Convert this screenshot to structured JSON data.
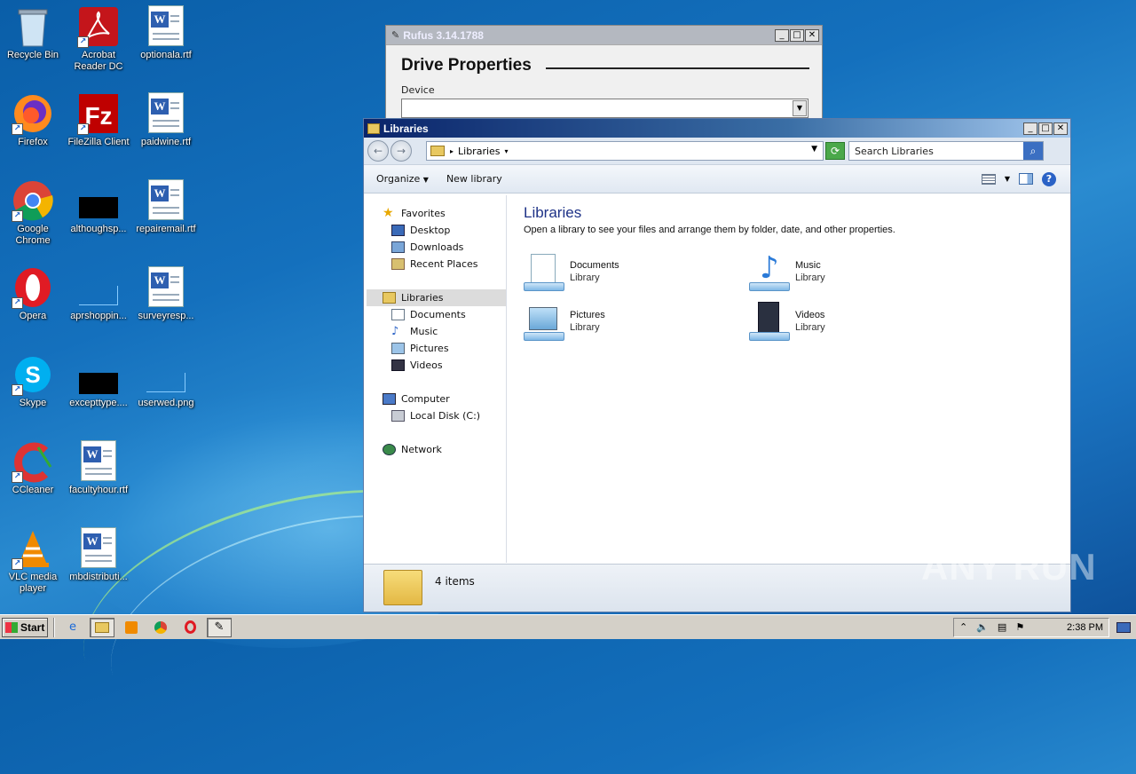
{
  "desktop": {
    "icons": [
      {
        "label": "Recycle Bin",
        "icon": "recycle-bin-icon"
      },
      {
        "label": "Acrobat Reader DC",
        "icon": "acrobat-icon"
      },
      {
        "label": "optionala.rtf",
        "icon": "word-doc-icon"
      },
      {
        "label": "Firefox",
        "icon": "firefox-icon"
      },
      {
        "label": "FileZilla Client",
        "icon": "filezilla-icon"
      },
      {
        "label": "paidwine.rtf",
        "icon": "word-doc-icon"
      },
      {
        "label": "Google Chrome",
        "icon": "chrome-icon"
      },
      {
        "label": "althoughsp...",
        "icon": "black-file-icon"
      },
      {
        "label": "repairemail.rtf",
        "icon": "word-doc-icon"
      },
      {
        "label": "Opera",
        "icon": "opera-icon"
      },
      {
        "label": "aprshoppin...",
        "icon": "blank-file-icon"
      },
      {
        "label": "surveyresp...",
        "icon": "word-doc-icon"
      },
      {
        "label": "Skype",
        "icon": "skype-icon"
      },
      {
        "label": "excepttype....",
        "icon": "black-file-icon"
      },
      {
        "label": "userwed.png",
        "icon": "blank-file-icon"
      },
      {
        "label": "CCleaner",
        "icon": "ccleaner-icon"
      },
      {
        "label": "facultyhour.rtf",
        "icon": "word-doc-icon"
      },
      {
        "label": "VLC media player",
        "icon": "vlc-icon"
      },
      {
        "label": "mbdistributi...",
        "icon": "word-doc-icon"
      }
    ]
  },
  "rufus": {
    "title": "Rufus 3.14.1788",
    "heading": "Drive Properties",
    "device_label": "Device",
    "device_value": ""
  },
  "explorer": {
    "title": "Libraries",
    "address": {
      "crumb": "Libraries"
    },
    "search": {
      "placeholder": "Search Libraries"
    },
    "commands": {
      "organize": "Organize",
      "new_library": "New library"
    },
    "nav": {
      "favorites": "Favorites",
      "desktop": "Desktop",
      "downloads": "Downloads",
      "recent": "Recent Places",
      "libraries": "Libraries",
      "documents": "Documents",
      "music": "Music",
      "pictures": "Pictures",
      "videos": "Videos",
      "computer": "Computer",
      "local_disk": "Local Disk (C:)",
      "network": "Network"
    },
    "main": {
      "heading": "Libraries",
      "description": "Open a library to see your files and arrange them by folder, date, and other properties.",
      "libraries": [
        {
          "name": "Documents",
          "type": "Library",
          "icon": "documents-library-icon"
        },
        {
          "name": "Music",
          "type": "Library",
          "icon": "music-library-icon"
        },
        {
          "name": "Pictures",
          "type": "Library",
          "icon": "pictures-library-icon"
        },
        {
          "name": "Videos",
          "type": "Library",
          "icon": "videos-library-icon"
        }
      ]
    },
    "status": {
      "count": "4 items"
    }
  },
  "taskbar": {
    "start_label": "Start",
    "clock": "2:38 PM"
  },
  "watermark": "ANY RUN"
}
